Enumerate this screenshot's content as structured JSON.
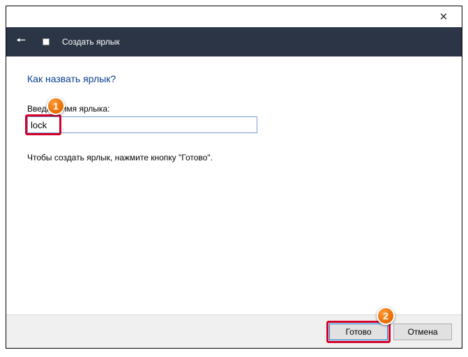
{
  "navbar": {
    "title": "Создать ярлык"
  },
  "content": {
    "heading": "Как назвать ярлык?",
    "field_label": "Введите имя ярлыка:",
    "input_value": "lock",
    "help_text": "Чтобы создать ярлык, нажмите кнопку \"Готово\"."
  },
  "footer": {
    "primary_label": "Готово",
    "cancel_label": "Отмена"
  },
  "annotations": {
    "badge1": "1",
    "badge2": "2"
  }
}
